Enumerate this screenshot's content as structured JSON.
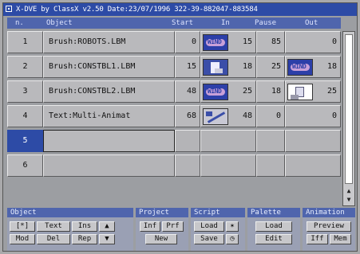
{
  "window": {
    "title": "X-DVE by ClassX v2.50 Date:23/07/1996 322-39-882047-883584"
  },
  "columns": {
    "n": "n.",
    "object": "Object",
    "start": "Start",
    "in": "In",
    "pause": "Pause",
    "out": "Out"
  },
  "rows": [
    {
      "n": "1",
      "object": "Brush:ROBOTS.LBM",
      "start": "0",
      "in_icon": "wind-icon",
      "in_val": "15",
      "pause": "85",
      "out_icon": "",
      "out_val": "0"
    },
    {
      "n": "2",
      "object": "Brush:CONSTBL1.LBM",
      "start": "15",
      "in_icon": "page-turn-icon",
      "in_val": "18",
      "pause": "25",
      "out_icon": "wind-icon",
      "out_val": "18"
    },
    {
      "n": "3",
      "object": "Brush:CONSTBL2.LBM",
      "start": "48",
      "in_icon": "wind-icon",
      "in_val": "25",
      "pause": "18",
      "out_icon": "page-turn-icon",
      "out_val": "25"
    },
    {
      "n": "4",
      "object": "Text:Multi-Animat",
      "start": "68",
      "in_icon": "diagonal-wipe-icon",
      "in_val": "48",
      "pause": "0",
      "out_icon": "",
      "out_val": "0"
    },
    {
      "n": "5",
      "object": "",
      "start": "",
      "in_val": "",
      "pause": "",
      "out_val": ""
    },
    {
      "n": "6",
      "object": "",
      "start": "",
      "in_val": "",
      "pause": "",
      "out_val": ""
    }
  ],
  "panels": {
    "object": {
      "title": "Object",
      "text": "Text",
      "ins": "Ins",
      "mod": "Mod",
      "del": "Del",
      "rep": "Rep",
      "clip": "[*]",
      "up": "▲",
      "down": "▼"
    },
    "project": {
      "title": "Project",
      "inf": "Inf",
      "prf": "Prf",
      "new": "New"
    },
    "script": {
      "title": "Script",
      "load": "Load",
      "save": "Save"
    },
    "palette": {
      "title": "Palette",
      "load": "Load",
      "edit": "Edit"
    },
    "animation": {
      "title": "Animation",
      "preview": "Preview",
      "iff": "Iff",
      "mem": "Mem"
    }
  },
  "colors": {
    "titlebar": "#2d4ba6",
    "header": "#4f65ad",
    "selected": "#2d4ba6",
    "cell": "#b9b9bc"
  }
}
